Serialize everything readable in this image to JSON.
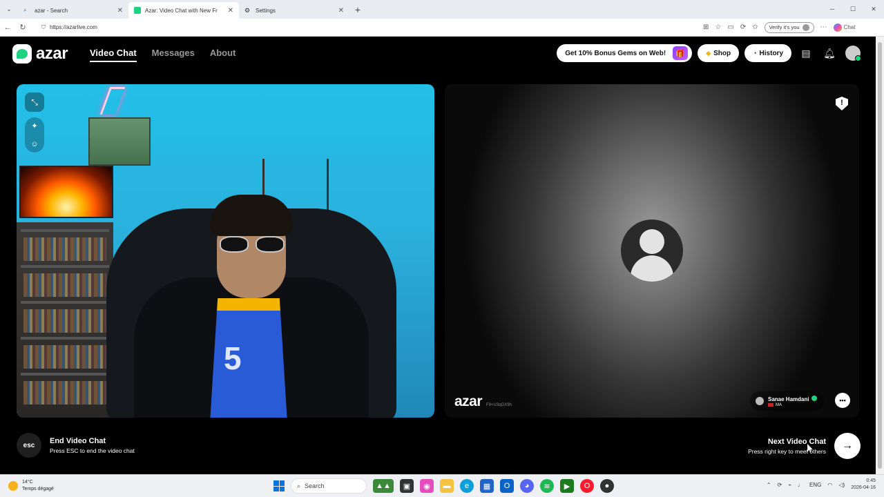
{
  "browser": {
    "tabs": [
      {
        "title": "azar - Search",
        "icon": "search-icon",
        "active": false
      },
      {
        "title": "Azar: Video Chat with New Fr",
        "icon": "azar-favicon",
        "active": true
      },
      {
        "title": "Settings",
        "icon": "gear-icon",
        "active": false
      }
    ],
    "url": "https://azarlive.com",
    "verify_label": "Verify it's you",
    "copilot_label": "Chat"
  },
  "app": {
    "logo_text": "azar",
    "nav": {
      "items": [
        {
          "label": "Video Chat",
          "active": true
        },
        {
          "label": "Messages",
          "active": false
        },
        {
          "label": "About",
          "active": false
        }
      ],
      "bonus_label": "Get 10% Bonus Gems on Web!",
      "shop_label": "Shop",
      "history_label": "History"
    },
    "remote": {
      "watermark": "azar",
      "watermark_code": "F9+U3qGX9h",
      "partner_name": "Sanae Hamdani",
      "partner_country": "MA"
    },
    "controls": {
      "esc_key": "esc",
      "end_title": "End Video Chat",
      "end_sub": "Press ESC to end the video chat",
      "next_title": "Next Video Chat",
      "next_sub": "Press right key to meet others"
    },
    "jersey_number": "5"
  },
  "taskbar": {
    "weather_temp": "14°C",
    "weather_desc": "Temps dégagé",
    "search_label": "Search",
    "lang": "ENG",
    "time": "0:45",
    "date": "2026-04-16"
  },
  "colors": {
    "brand_green": "#1ed37f",
    "gift_purple": "#8b3dff",
    "left_video_bg": "#22c0e8"
  }
}
